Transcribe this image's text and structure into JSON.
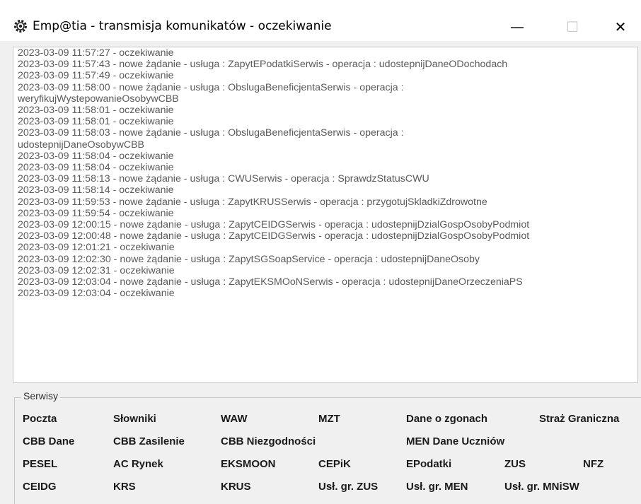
{
  "window": {
    "title": "Emp@tia - transmisja komunikatów - oczekiwanie",
    "minimize_glyph": "—",
    "maximize_glyph": "☐",
    "close_glyph": "✕"
  },
  "log": [
    "2023-03-09 11:57:27 - oczekiwanie",
    "2023-03-09 11:57:43 - nowe żądanie - usługa : ZapytEPodatkiSerwis - operacja : udostepnijDaneODochodach",
    "2023-03-09 11:57:49 - oczekiwanie",
    "2023-03-09 11:58:00 - nowe żądanie - usługa : ObslugaBeneficjentaSerwis - operacja :",
    "weryfikujWystepowanieOsobywCBB",
    "2023-03-09 11:58:01 - oczekiwanie",
    "2023-03-09 11:58:01 - oczekiwanie",
    "2023-03-09 11:58:03 - nowe żądanie - usługa : ObslugaBeneficjentaSerwis - operacja :",
    "udostepnijDaneOsobywCBB",
    "2023-03-09 11:58:04 - oczekiwanie",
    "2023-03-09 11:58:04 - oczekiwanie",
    "2023-03-09 11:58:13 - nowe żądanie - usługa : CWUSerwis - operacja : SprawdzStatusCWU",
    "2023-03-09 11:58:14 - oczekiwanie",
    "2023-03-09 11:59:53 - nowe żądanie - usługa : ZapytKRUSSerwis - operacja : przygotujSkladkiZdrowotne",
    "2023-03-09 11:59:54 - oczekiwanie",
    "2023-03-09 12:00:15 - nowe żądanie - usługa : ZapytCEIDGSerwis - operacja : udostepnijDzialGospOsobyPodmiot",
    "2023-03-09 12:00:48 - nowe żądanie - usługa : ZapytCEIDGSerwis - operacja : udostepnijDzialGospOsobyPodmiot",
    "2023-03-09 12:01:21 - oczekiwanie",
    "2023-03-09 12:02:30 - nowe żądanie - usługa : ZapytSGSoapService - operacja : udostepnijDaneOsoby",
    "2023-03-09 12:02:31 - oczekiwanie",
    "2023-03-09 12:03:04 - nowe żądanie - usługa : ZapytEKSMOoNSerwis - operacja : udostepnijDaneOrzeczeniaPS",
    "2023-03-09 12:03:04 - oczekiwanie"
  ],
  "services": {
    "group_label": "Serwisy",
    "items": [
      "Poczta",
      "Słowniki",
      "WAW",
      "MZT",
      "Dane o zgonach",
      "Straż Graniczna",
      "CBB Dane",
      "CBB Zasilenie",
      "CBB Niezgodności",
      "MEN Dane Uczniów",
      "PESEL",
      "AC Rynek",
      "EKSMOON",
      "CEPiK",
      "EPodatki",
      "ZUS",
      "NFZ",
      "CEIDG",
      "KRS",
      "KRUS",
      "Usł. gr. ZUS",
      "Usł. gr. MEN",
      "Usł. gr. MNiSW"
    ]
  }
}
